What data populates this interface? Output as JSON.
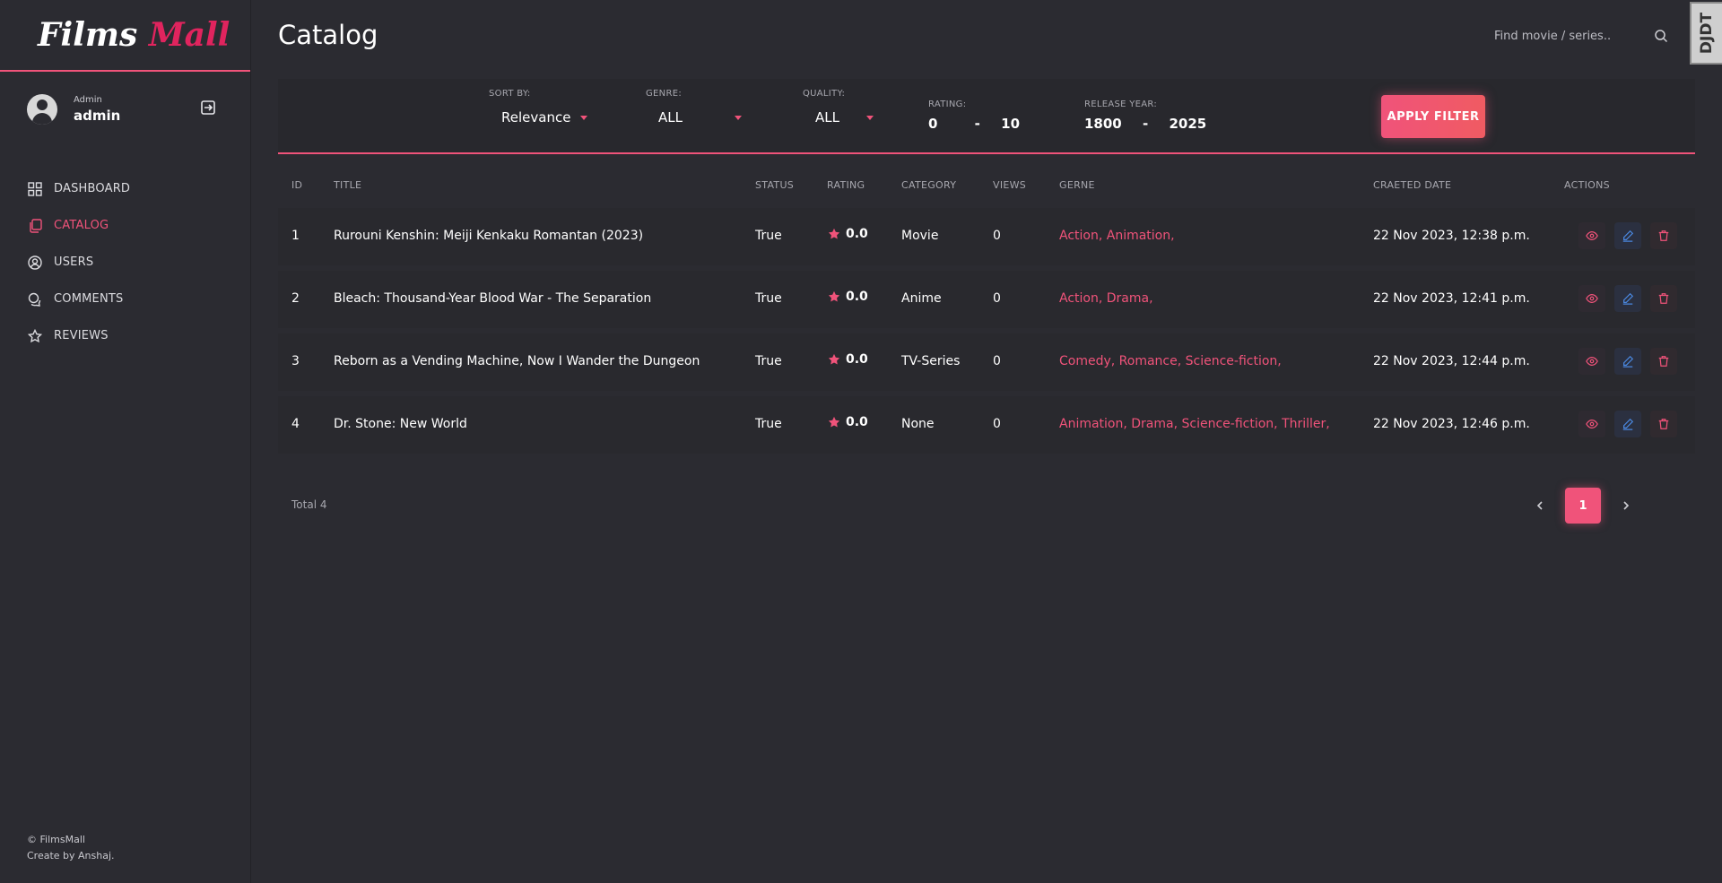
{
  "brand": {
    "part1": "Films",
    "part2": "Mall"
  },
  "user": {
    "role": "Admin",
    "name": "admin"
  },
  "nav": [
    {
      "label": "DASHBOARD",
      "icon": "dashboard-icon"
    },
    {
      "label": "CATALOG",
      "icon": "catalog-icon",
      "active": true
    },
    {
      "label": "USERS",
      "icon": "users-icon"
    },
    {
      "label": "COMMENTS",
      "icon": "comments-icon"
    },
    {
      "label": "REVIEWS",
      "icon": "reviews-icon"
    }
  ],
  "footer": {
    "copyright": "© FilmsMall",
    "credit": "Create by Anshaj."
  },
  "header": {
    "title": "Catalog",
    "search_placeholder": "Find movie / series..",
    "badge": "DJDT"
  },
  "filters": {
    "sort_label": "SORT BY:",
    "sort_value": "Relevance",
    "genre_label": "GENRE:",
    "genre_value": "ALL",
    "quality_label": "QUALITY:",
    "quality_value": "ALL",
    "rating_label": "RATING:",
    "rating_min": "0",
    "rating_max": "10",
    "year_label": "RELEASE YEAR:",
    "year_min": "1800",
    "year_max": "2025",
    "range_sep": "-",
    "apply_label": "APPLY FILTER"
  },
  "table": {
    "headers": {
      "id": "ID",
      "title": "TITLE",
      "status": "STATUS",
      "rating": "RATING",
      "category": "CATEGORY",
      "views": "VIEWS",
      "genre": "GERNE",
      "created": "CRAETED DATE",
      "actions": "ACTIONS"
    },
    "rows": [
      {
        "id": "1",
        "title": "Rurouni Kenshin: Meiji Kenkaku Romantan (2023)",
        "status": "True",
        "rating": "0.0",
        "category": "Movie",
        "views": "0",
        "genre": "Action, Animation,",
        "created": "22 Nov 2023, 12:38 p.m."
      },
      {
        "id": "2",
        "title": "Bleach: Thousand-Year Blood War - The Separation",
        "status": "True",
        "rating": "0.0",
        "category": "Anime",
        "views": "0",
        "genre": "Action, Drama,",
        "created": "22 Nov 2023, 12:41 p.m."
      },
      {
        "id": "3",
        "title": "Reborn as a Vending Machine, Now I Wander the Dungeon",
        "status": "True",
        "rating": "0.0",
        "category": "TV-Series",
        "views": "0",
        "genre": "Comedy, Romance, Science-fiction,",
        "created": "22 Nov 2023, 12:44 p.m."
      },
      {
        "id": "4",
        "title": "Dr. Stone: New World",
        "status": "True",
        "rating": "0.0",
        "category": "None",
        "views": "0",
        "genre": "Animation, Drama, Science-fiction, Thriller,",
        "created": "22 Nov 2023, 12:46 p.m."
      }
    ],
    "total": "Total 4",
    "current_page": "1"
  },
  "colors": {
    "accent": "#f0537a",
    "background": "#2b2b31",
    "edit": "#4a88e0"
  }
}
